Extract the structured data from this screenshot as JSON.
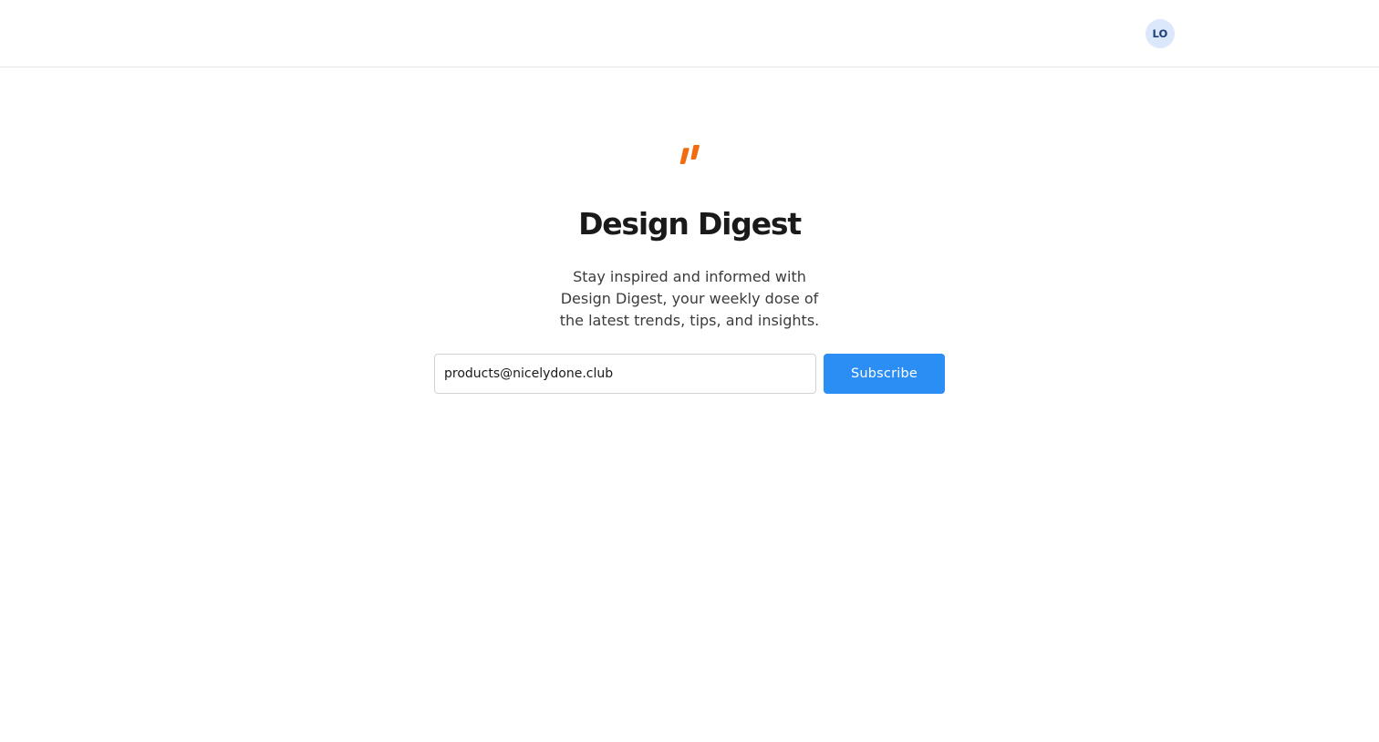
{
  "header": {
    "avatar_initials": "LO"
  },
  "brand": {
    "logo_icon": "double-slash-logo-icon",
    "logo_color": "#f26b0f",
    "title": "Design Digest",
    "description": "Stay inspired and informed with Design Digest, your weekly dose of the latest trends, tips, and insights."
  },
  "form": {
    "email_value": "products@nicelydone.club",
    "email_placeholder": "",
    "subscribe_label": "Subscribe",
    "button_color": "#2b8ef5"
  }
}
